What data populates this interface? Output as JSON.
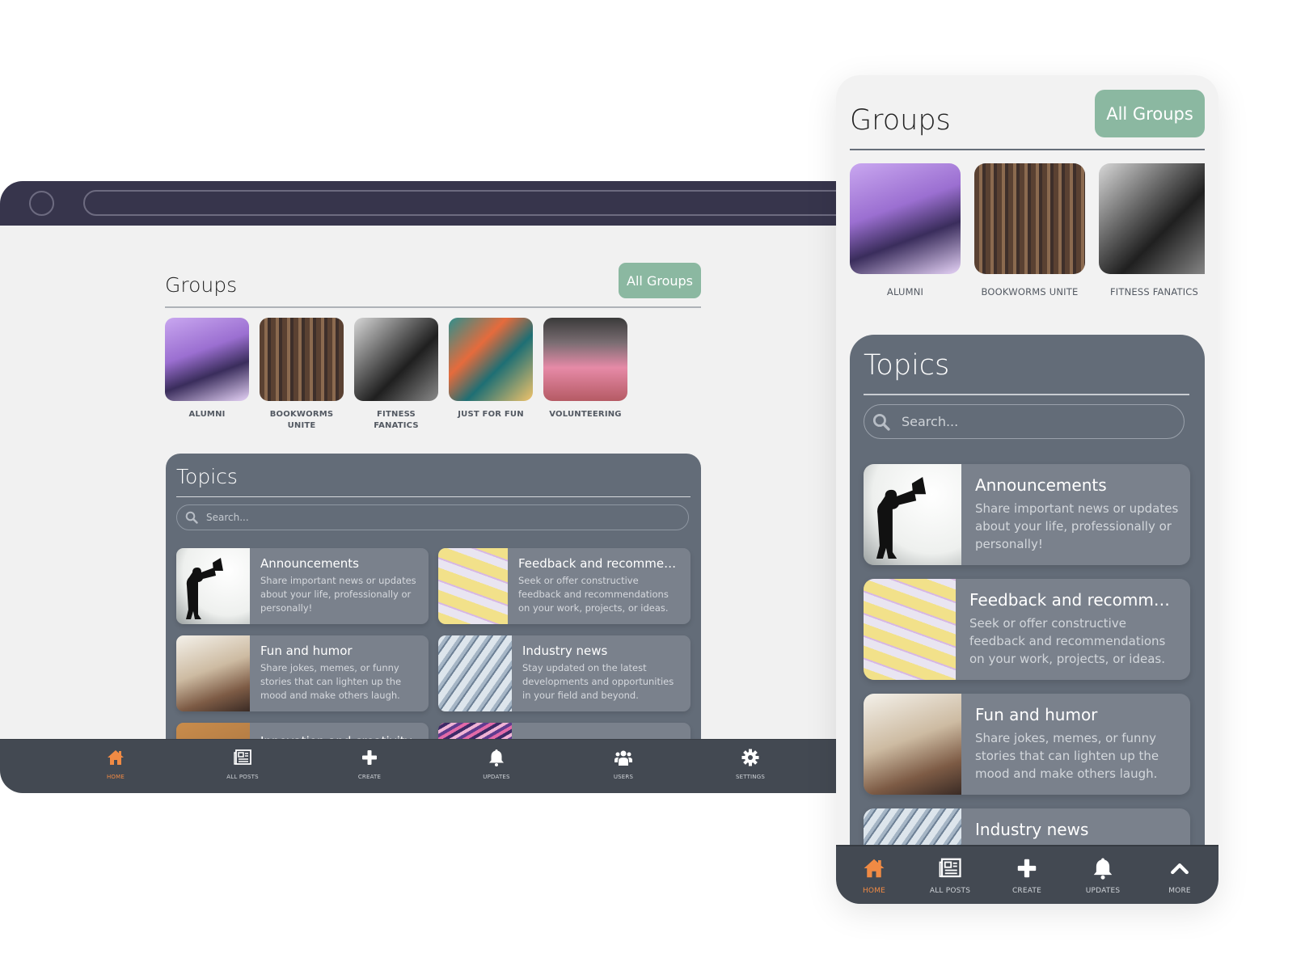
{
  "desktop": {
    "groups": {
      "title": "Groups",
      "all_groups_label": "All Groups",
      "items": [
        {
          "label": "ALUMNI",
          "image": "alumni"
        },
        {
          "label": "BOOKWORMS UNITE",
          "image": "books"
        },
        {
          "label": "FITNESS FANATICS",
          "image": "fitness"
        },
        {
          "label": "JUST FOR FUN",
          "image": "fun"
        },
        {
          "label": "VOLUNTEERING",
          "image": "volunteer"
        }
      ]
    },
    "topics": {
      "title": "Topics",
      "search_placeholder": "Search...",
      "items": [
        {
          "title": "Announcements",
          "description": "Share important news or updates about your life, professionally or personally!",
          "image": "announce"
        },
        {
          "title": "Feedback and recommendations",
          "description": "Seek or offer constructive feedback and recommendations on your work, projects, or ideas.",
          "image": "feedback"
        },
        {
          "title": "Fun and humor",
          "description": "Share jokes, memes, or funny stories that can lighten up the mood and make others laugh.",
          "image": "funhumor"
        },
        {
          "title": "Industry news",
          "description": "Stay updated on the latest developments and opportunities in your field and beyond.",
          "image": "industry"
        },
        {
          "title": "Innovation and creativity",
          "description": "",
          "image": "innov"
        },
        {
          "title": "",
          "description": "",
          "image": "other"
        }
      ]
    },
    "nav": [
      {
        "label": "HOME",
        "icon": "home-icon",
        "active": true
      },
      {
        "label": "ALL POSTS",
        "icon": "newspaper-icon",
        "active": false
      },
      {
        "label": "CREATE",
        "icon": "plus-icon",
        "active": false
      },
      {
        "label": "UPDATES",
        "icon": "bell-icon",
        "active": false
      },
      {
        "label": "USERS",
        "icon": "users-icon",
        "active": false
      },
      {
        "label": "SETTINGS",
        "icon": "gear-icon",
        "active": false
      }
    ]
  },
  "mobile": {
    "groups": {
      "title": "Groups",
      "all_groups_label": "All Groups",
      "items": [
        {
          "label": "ALUMNI",
          "image": "alumni"
        },
        {
          "label": "BOOKWORMS UNITE",
          "image": "books"
        },
        {
          "label": "FITNESS FANATICS",
          "image": "fitness"
        }
      ]
    },
    "topics": {
      "title": "Topics",
      "search_placeholder": "Search...",
      "items": [
        {
          "title": "Announcements",
          "description": "Share important news or updates about your life, professionally or personally!",
          "image": "announce"
        },
        {
          "title": "Feedback and recommendations",
          "description": "Seek or offer constructive feedback and recommendations on your work, projects, or ideas.",
          "image": "feedback"
        },
        {
          "title": "Fun and humor",
          "description": "Share jokes, memes, or funny stories that can lighten up the mood and make others laugh.",
          "image": "funhumor"
        },
        {
          "title": "Industry news",
          "description": "",
          "image": "industry"
        }
      ]
    },
    "nav": [
      {
        "label": "HOME",
        "icon": "home-icon",
        "active": true
      },
      {
        "label": "ALL POSTS",
        "icon": "newspaper-icon",
        "active": false
      },
      {
        "label": "CREATE",
        "icon": "plus-icon",
        "active": false
      },
      {
        "label": "UPDATES",
        "icon": "bell-icon",
        "active": false
      },
      {
        "label": "MORE",
        "icon": "chevron-up-icon",
        "active": false
      }
    ]
  },
  "colors": {
    "accent_green": "#8bb8a1",
    "active_orange": "#f08a44",
    "topics_panel": "#636c78",
    "nav_bar": "#434952",
    "browser_bar": "#37354c"
  }
}
